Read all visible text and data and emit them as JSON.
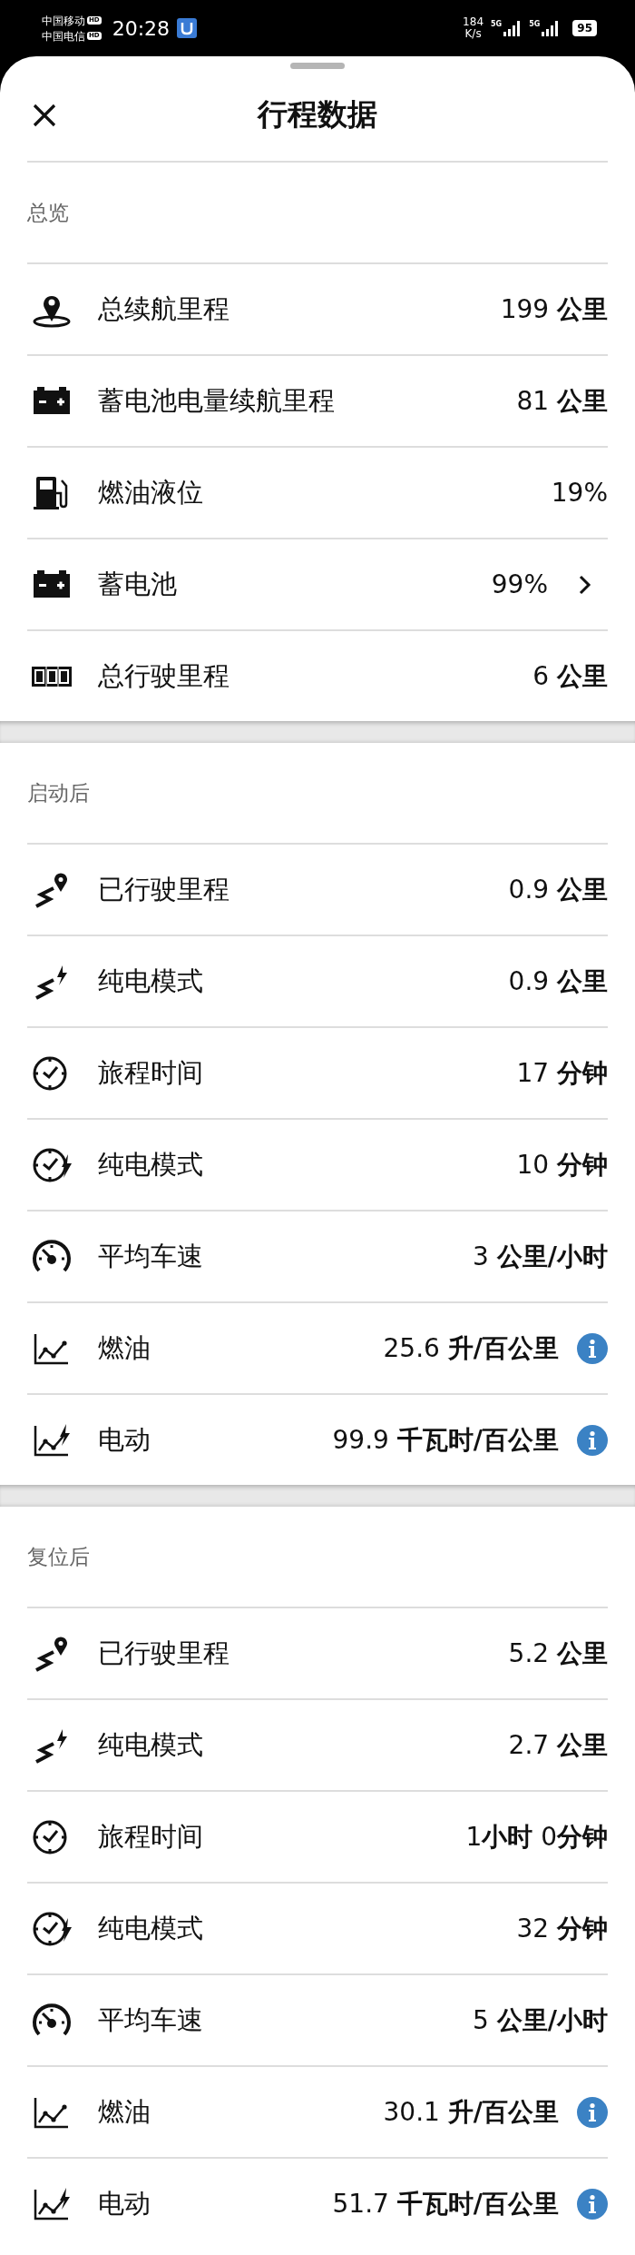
{
  "status_bar": {
    "carriers": [
      {
        "name": "中国移动",
        "badge": "HD"
      },
      {
        "name": "中国电信",
        "badge": "HD"
      }
    ],
    "time": "20:28",
    "net_speed": "184",
    "net_speed_unit": "K/s",
    "sims": [
      {
        "network": "5G"
      },
      {
        "network": "5G"
      }
    ],
    "battery": "95"
  },
  "sheet": {
    "title": "行程数据"
  },
  "sections": [
    {
      "title": "总览",
      "rows": [
        {
          "label": "总续航里程",
          "value": "199 **公里**",
          "chevron": false,
          "info": false
        },
        {
          "label": "蓄电池电量续航里程",
          "value": "81 **公里**",
          "chevron": false,
          "info": false
        },
        {
          "label": "燃油液位",
          "value": "19%",
          "chevron": false,
          "info": false
        },
        {
          "label": "蓄电池",
          "value": "99%",
          "chevron": true,
          "info": false
        },
        {
          "label": "总行驶里程",
          "value": "6 **公里**",
          "chevron": false,
          "info": false
        }
      ]
    },
    {
      "title": "启动后",
      "rows": [
        {
          "label": "已行驶里程",
          "value": "0.9 **公里**",
          "chevron": false,
          "info": false
        },
        {
          "label": "纯电模式",
          "value": "0.9 **公里**",
          "chevron": false,
          "info": false
        },
        {
          "label": "旅程时间",
          "value": "17 **分钟**",
          "chevron": false,
          "info": false
        },
        {
          "label": "纯电模式",
          "value": "10 **分钟**",
          "chevron": false,
          "info": false
        },
        {
          "label": "平均车速",
          "value": "3 **公里/小时**",
          "chevron": false,
          "info": false
        },
        {
          "label": "燃油",
          "value": "25.6 **升/百公里**",
          "chevron": false,
          "info": true
        },
        {
          "label": "电动",
          "value": "99.9 **千瓦时/百公里**",
          "chevron": false,
          "info": true
        }
      ]
    },
    {
      "title": "复位后",
      "rows": [
        {
          "label": "已行驶里程",
          "value": "5.2 **公里**",
          "chevron": false,
          "info": false
        },
        {
          "label": "纯电模式",
          "value": "2.7 **公里**",
          "chevron": false,
          "info": false
        },
        {
          "label": "旅程时间",
          "value": "1**小时** 0**分钟**",
          "chevron": false,
          "info": false
        },
        {
          "label": "纯电模式",
          "value": "32 **分钟**",
          "chevron": false,
          "info": false
        },
        {
          "label": "平均车速",
          "value": "5 **公里/小时**",
          "chevron": false,
          "info": false
        },
        {
          "label": "燃油",
          "value": "30.1 **升/百公里**",
          "chevron": false,
          "info": true
        },
        {
          "label": "电动",
          "value": "51.7 **千瓦时/百公里**",
          "chevron": false,
          "info": true
        }
      ]
    }
  ]
}
